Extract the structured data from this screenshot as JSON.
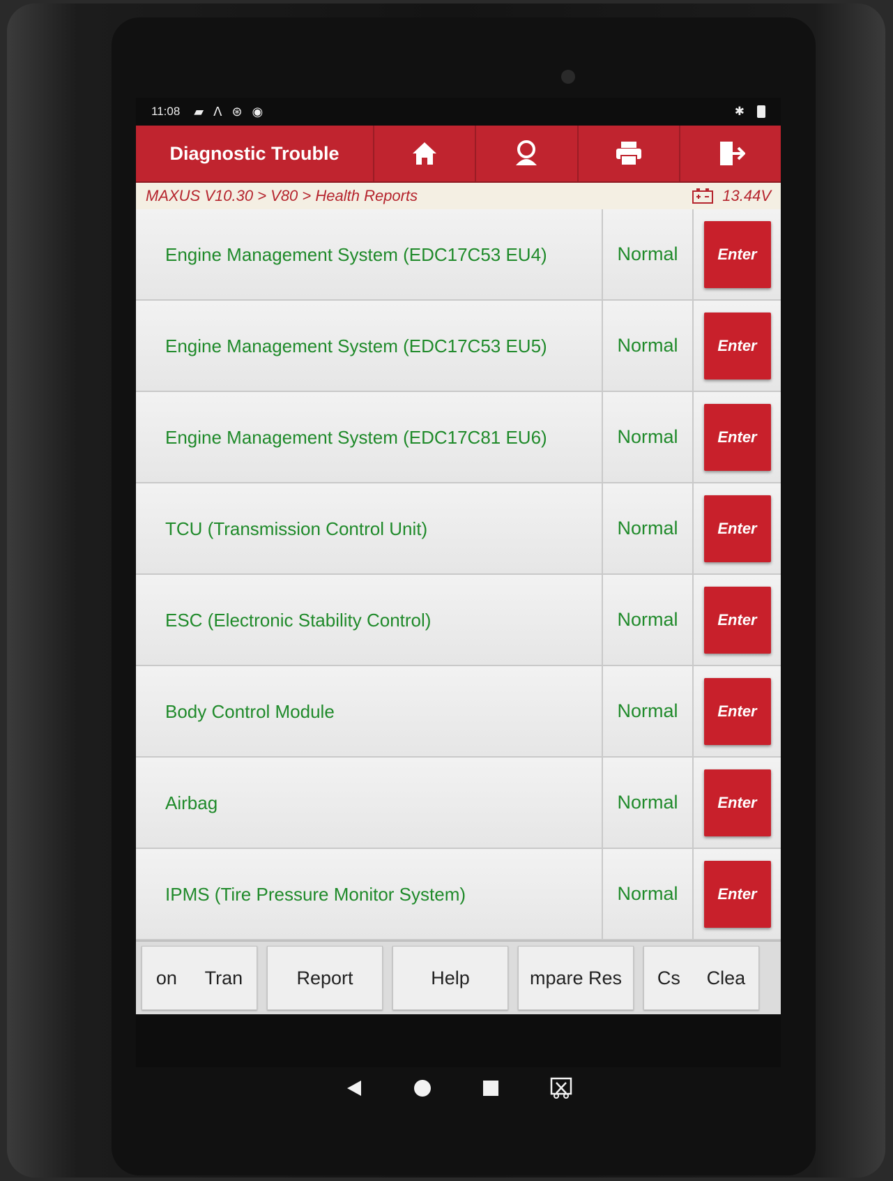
{
  "status_bar": {
    "time": "11:08",
    "left_icons": [
      "image-icon",
      "stethoscope-icon",
      "settings-circle-icon",
      "chrome-icon"
    ],
    "right_icons": [
      "bluetooth-icon",
      "battery-icon"
    ]
  },
  "header": {
    "title": "Diagnostic Trouble",
    "buttons": [
      "home-icon",
      "user-icon",
      "printer-icon",
      "exit-icon"
    ],
    "accent_color": "#c0242f"
  },
  "breadcrumb": {
    "path": "MAXUS V10.30 > V80 > Health Reports",
    "voltage": "13.44V"
  },
  "systems": [
    {
      "name": "Engine Management System (EDC17C53 EU4)",
      "status": "Normal",
      "action": "Enter"
    },
    {
      "name": "Engine Management System (EDC17C53 EU5)",
      "status": "Normal",
      "action": "Enter"
    },
    {
      "name": "Engine Management System (EDC17C81 EU6)",
      "status": "Normal",
      "action": "Enter"
    },
    {
      "name": "TCU (Transmission Control Unit)",
      "status": "Normal",
      "action": "Enter"
    },
    {
      "name": "ESC (Electronic Stability Control)",
      "status": "Normal",
      "action": "Enter"
    },
    {
      "name": "Body Control Module",
      "status": "Normal",
      "action": "Enter"
    },
    {
      "name": "Airbag",
      "status": "Normal",
      "action": "Enter"
    },
    {
      "name": "IPMS (Tire Pressure Monitor System)",
      "status": "Normal",
      "action": "Enter"
    }
  ],
  "toolbar": {
    "btn1_a": "on",
    "btn1_b": "Tran",
    "btn2": "Report",
    "btn3": "Help",
    "btn4": "mpare Res",
    "btn5_a": "Cs",
    "btn5_b": "Clea"
  },
  "nav": [
    "back-icon",
    "home-circle-icon",
    "recents-icon",
    "screenshot-icon"
  ],
  "colors": {
    "status_green": "#1f8a2a",
    "enter_red": "#c8202b"
  }
}
